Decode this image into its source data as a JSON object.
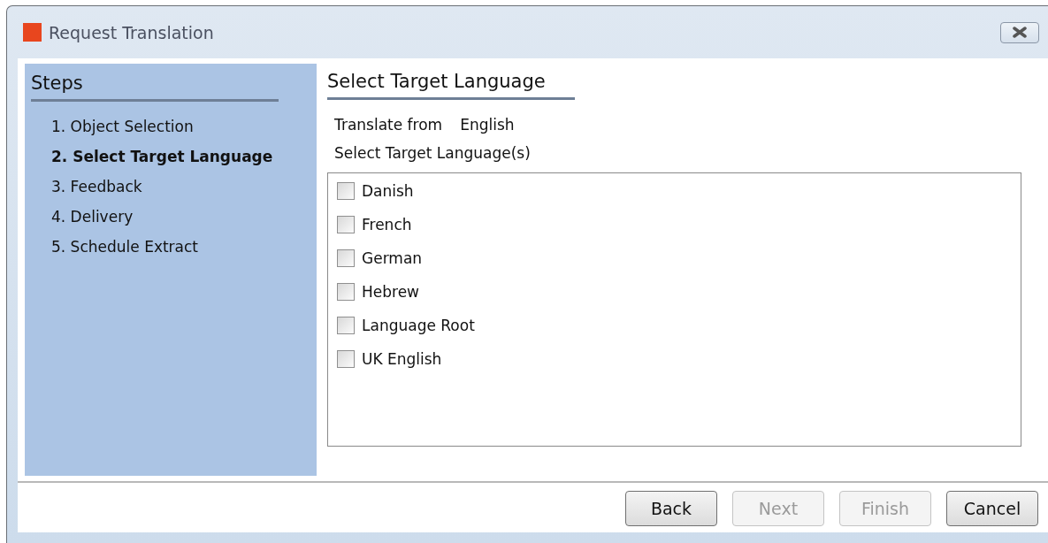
{
  "window": {
    "title": "Request Translation"
  },
  "sidebar": {
    "title": "Steps",
    "items": [
      {
        "label": "1. Object Selection",
        "selected": false
      },
      {
        "label": "2. Select Target Language",
        "selected": true
      },
      {
        "label": "3. Feedback",
        "selected": false
      },
      {
        "label": "4. Delivery",
        "selected": false
      },
      {
        "label": "5. Schedule Extract",
        "selected": false
      }
    ]
  },
  "main": {
    "title": "Select Target Language",
    "translate_from_label": "Translate from",
    "translate_from_value": "English",
    "list_label": "Select Target Language(s)",
    "languages": [
      {
        "label": "Danish",
        "checked": false
      },
      {
        "label": "French",
        "checked": false
      },
      {
        "label": "German",
        "checked": false
      },
      {
        "label": "Hebrew",
        "checked": false
      },
      {
        "label": "Language Root",
        "checked": false
      },
      {
        "label": "UK English",
        "checked": false
      }
    ]
  },
  "buttons": [
    {
      "label": "Back",
      "disabled": false
    },
    {
      "label": "Next",
      "disabled": true
    },
    {
      "label": "Finish",
      "disabled": true
    },
    {
      "label": "Cancel",
      "disabled": false
    }
  ]
}
